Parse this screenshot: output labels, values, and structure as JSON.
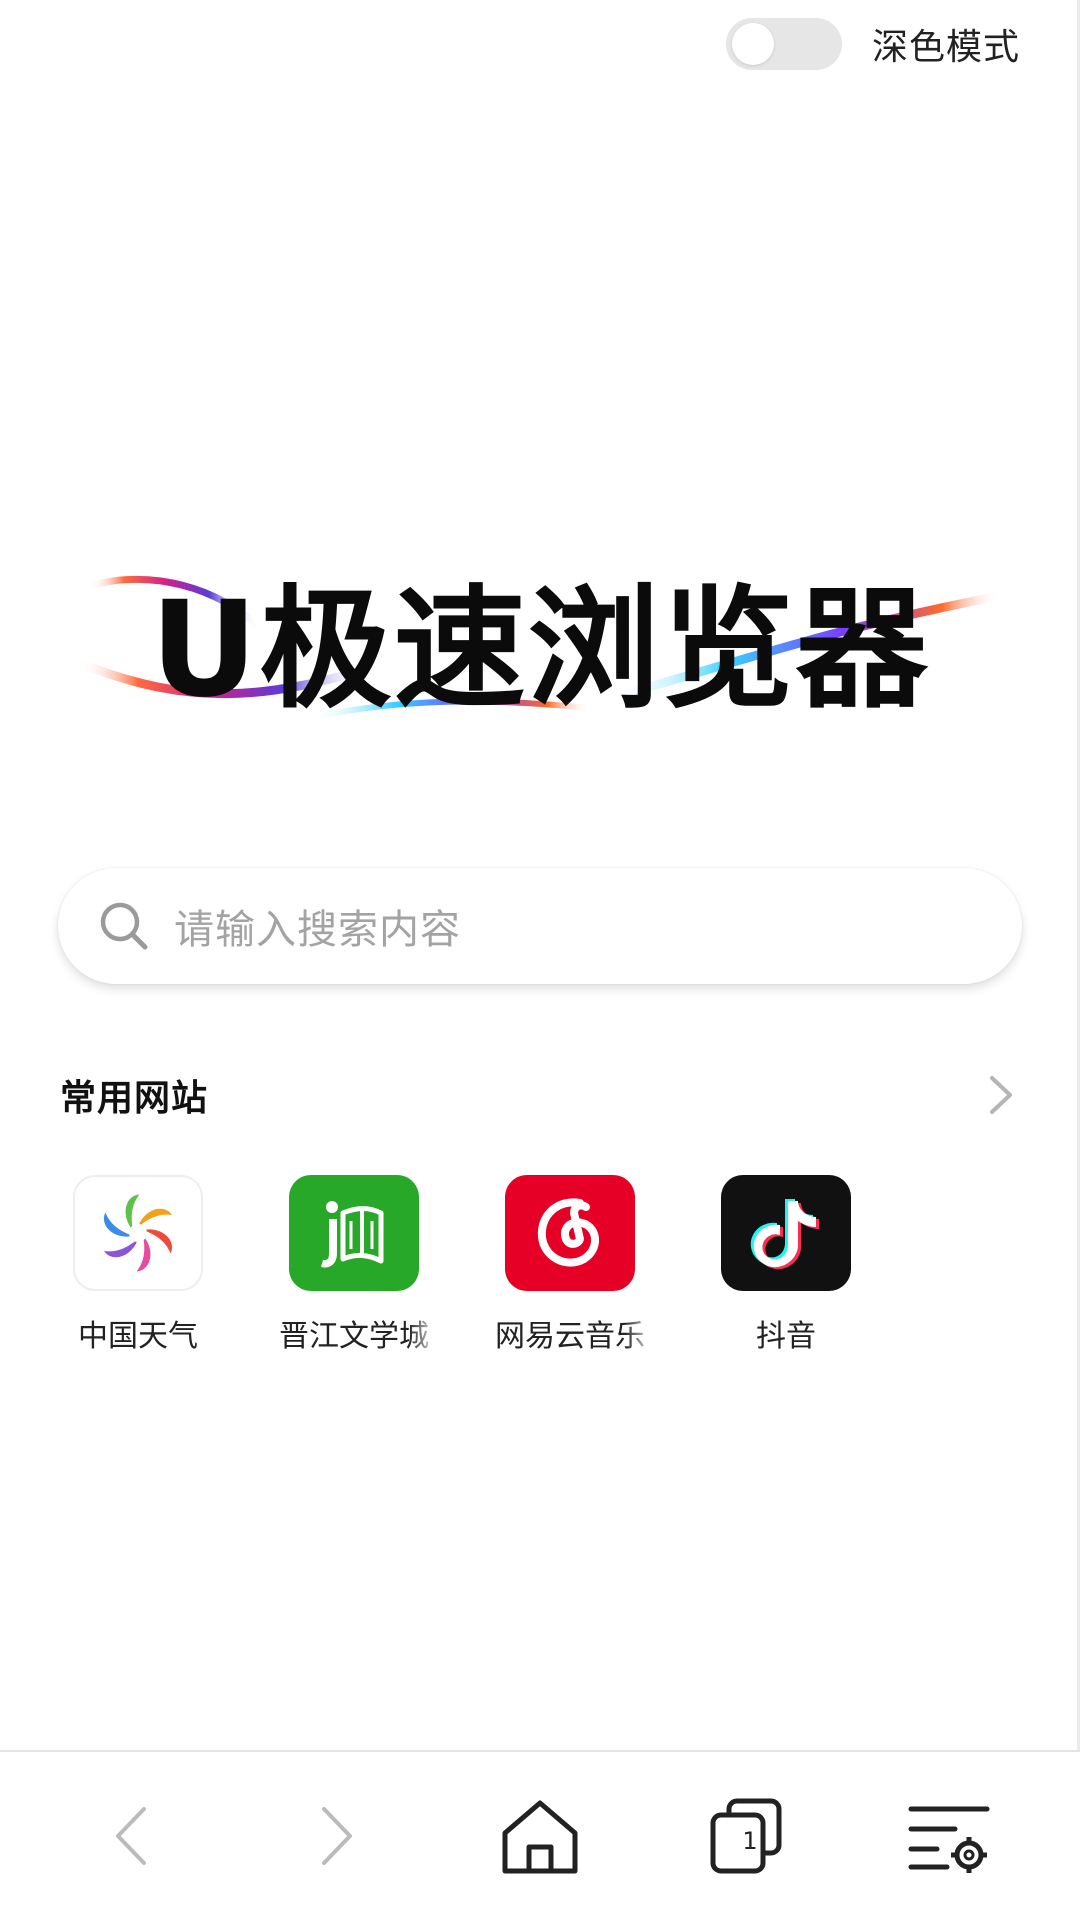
{
  "top_bar": {
    "dark_mode_label": "深色模式",
    "dark_mode_on": false
  },
  "logo": {
    "text": "U极速浏览器"
  },
  "search": {
    "placeholder": "请输入搜索内容",
    "icon": "search-icon"
  },
  "common_sites": {
    "title": "常用网站",
    "more_icon": "chevron-right-icon",
    "items": [
      {
        "label": "中国天气",
        "icon": "china-weather-icon"
      },
      {
        "label": "晋江文学城",
        "icon": "jjwxc-icon"
      },
      {
        "label": "网易云音乐",
        "icon": "netease-music-icon"
      },
      {
        "label": "抖音",
        "icon": "douyin-icon"
      }
    ]
  },
  "bottom_nav": {
    "back_icon": "chevron-left-icon",
    "forward_icon": "chevron-right-icon",
    "home_icon": "home-icon",
    "tabs_icon": "tabs-icon",
    "tabs_count": "1",
    "menu_icon": "menu-settings-icon"
  },
  "colors": {
    "background": "#ffffff",
    "text": "#222222",
    "placeholder": "#a3a3a3",
    "jjwxc_green": "#27a828",
    "netease_red": "#e60026",
    "douyin_black": "#111111"
  }
}
